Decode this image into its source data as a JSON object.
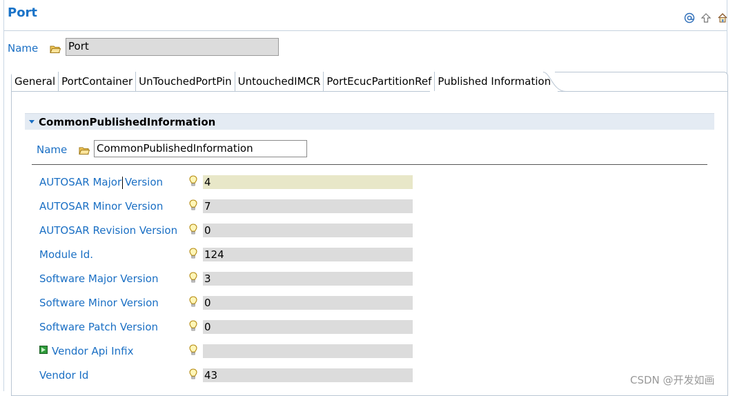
{
  "editor": {
    "title": "Port",
    "toolbar": [
      "at-icon",
      "arrow-up-icon",
      "home-icon"
    ]
  },
  "name_row": {
    "label": "Name",
    "value": "Port"
  },
  "tabs": [
    {
      "label": "General"
    },
    {
      "label": "PortContainer"
    },
    {
      "label": "UnTouchedPortPin"
    },
    {
      "label": "UntouchedIMCR"
    },
    {
      "label": "PortEcucPartitionRef"
    },
    {
      "label": "Published Information",
      "active": true
    }
  ],
  "section": {
    "title": "CommonPublishedInformation",
    "name_label": "Name",
    "name_value": "CommonPublishedInformation"
  },
  "fields": [
    {
      "label": "AUTOSAR Major Version",
      "value": "4"
    },
    {
      "label": "AUTOSAR Minor Version",
      "value": "7"
    },
    {
      "label": "AUTOSAR Revision Version",
      "value": "0"
    },
    {
      "label": "Module Id.",
      "value": "124"
    },
    {
      "label": "Software Major Version",
      "value": "3"
    },
    {
      "label": "Software Minor Version",
      "value": "0"
    },
    {
      "label": "Software Patch Version",
      "value": "0"
    },
    {
      "label": "Vendor Api Infix",
      "value": ""
    },
    {
      "label": "Vendor Id",
      "value": "43"
    }
  ],
  "watermark": "CSDN @开发如画",
  "colors": {
    "label_blue": "#1a6fc4",
    "title_blue": "#1a73c8",
    "field_gray": "#dcdcdc",
    "field_highlight": "#e8e7c8"
  }
}
